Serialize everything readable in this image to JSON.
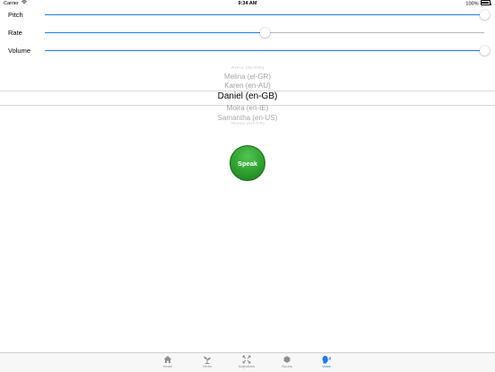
{
  "status_bar": {
    "carrier": "Carrier",
    "time": "9:34 AM",
    "battery": "100%"
  },
  "sliders": {
    "pitch": {
      "label": "Pitch",
      "value": 1.0
    },
    "rate": {
      "label": "Rate",
      "value": 0.5
    },
    "volume": {
      "label": "Volume",
      "value": 1.0
    }
  },
  "voice_picker": {
    "items": [
      "Anna (de-DE)",
      "Melina (el-GR)",
      "Karen (en-AU)",
      "Daniel (en-GB)",
      "Moira (en-IE)",
      "Samantha (en-US)",
      "Tessa (en-ZA)"
    ],
    "selected": "Daniel (en-GB)"
  },
  "speak_button": {
    "label": "Speak",
    "color": "#2fa02f"
  },
  "tab_bar": {
    "accent_color": "#1e7cf0",
    "tabs": [
      {
        "label": "Home",
        "icon": "home-icon",
        "active": false
      },
      {
        "label": "Verbs",
        "icon": "sprout-icon",
        "active": false
      },
      {
        "label": "Adjectives",
        "icon": "expand-icon",
        "active": false
      },
      {
        "label": "Nouns",
        "icon": "hexagon-icon",
        "active": false
      },
      {
        "label": "Voice",
        "icon": "speaking-head-icon",
        "active": true
      }
    ]
  }
}
